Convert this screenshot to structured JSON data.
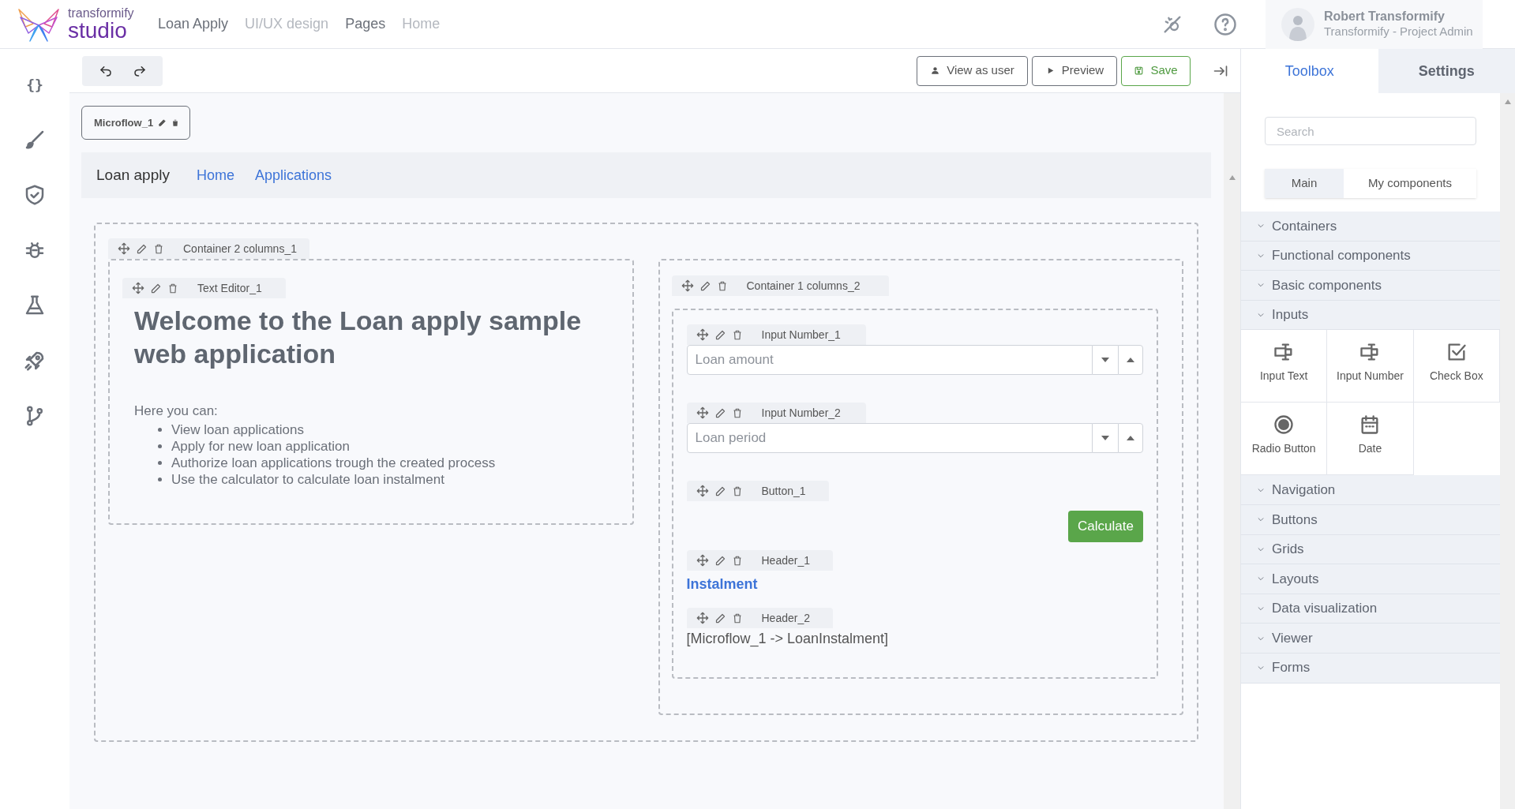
{
  "top_bar": {
    "logo_small": "transformify",
    "logo_large": "studio",
    "nav": [
      {
        "label": "Loan Apply",
        "dimmed": false
      },
      {
        "label": "UI/UX design",
        "dimmed": true
      },
      {
        "label": "Pages",
        "dimmed": false
      },
      {
        "label": "Home",
        "dimmed": true
      }
    ],
    "user": {
      "name": "Robert Transformify",
      "role": "Transformify - Project Admin"
    }
  },
  "sidebar": {
    "code_glyph": "{}"
  },
  "toolbar": {
    "buttons": [
      {
        "label": "View as user",
        "kind": "user"
      },
      {
        "label": "Preview",
        "kind": "play"
      },
      {
        "label": "Save",
        "kind": "save"
      }
    ]
  },
  "canvas": {
    "microflow": "Microflow_1",
    "navbar": {
      "brand": "Loan apply",
      "links": [
        "Home",
        "Applications"
      ]
    },
    "container": {
      "tag": "Container 2 columns_1",
      "left": {
        "tag": "Text Editor_1",
        "heading": "Welcome to the Loan apply sample web application",
        "intro": "Here you can:",
        "bullets": [
          "View loan applications",
          "Apply for new loan application",
          "Authorize loan applications trough the created process",
          "Use the calculator to calculate loan instalment"
        ]
      },
      "right": {
        "tag": "Container 1 columns_2",
        "components": [
          {
            "kind": "number-input",
            "tag": "Input Number_1",
            "placeholder": "Loan amount"
          },
          {
            "kind": "number-input",
            "tag": "Input Number_2",
            "placeholder": "Loan period"
          },
          {
            "kind": "button",
            "tag": "Button_1",
            "label": "Calculate"
          },
          {
            "kind": "title",
            "tag": "Header_1",
            "text": "Instalment"
          },
          {
            "kind": "binding",
            "tag": "Header_2",
            "text": "[Microflow_1 -> LoanInstalment]"
          }
        ]
      }
    }
  },
  "right_panel": {
    "tabs": [
      {
        "label": "Toolbox",
        "selected": true
      },
      {
        "label": "Settings",
        "selected": false
      }
    ],
    "search": {
      "placeholder": "Search"
    },
    "segments": [
      {
        "label": "Main",
        "selected": true
      },
      {
        "label": "My components",
        "selected": false
      }
    ],
    "sections": [
      {
        "label": "Containers"
      },
      {
        "label": "Functional components"
      },
      {
        "label": "Basic components"
      },
      {
        "label": "Inputs",
        "items": [
          {
            "label": "Input Text",
            "kind": "text-input"
          },
          {
            "label": "Input Number",
            "kind": "number-input"
          },
          {
            "label": "Check Box",
            "kind": "checkbox"
          },
          {
            "label": "Radio Button",
            "kind": "radio"
          },
          {
            "label": "Date",
            "kind": "date"
          }
        ]
      },
      {
        "label": "Navigation"
      },
      {
        "label": "Buttons"
      },
      {
        "label": "Grids"
      },
      {
        "label": "Layouts"
      },
      {
        "label": "Data visualization"
      },
      {
        "label": "Viewer"
      },
      {
        "label": "Forms"
      }
    ]
  }
}
